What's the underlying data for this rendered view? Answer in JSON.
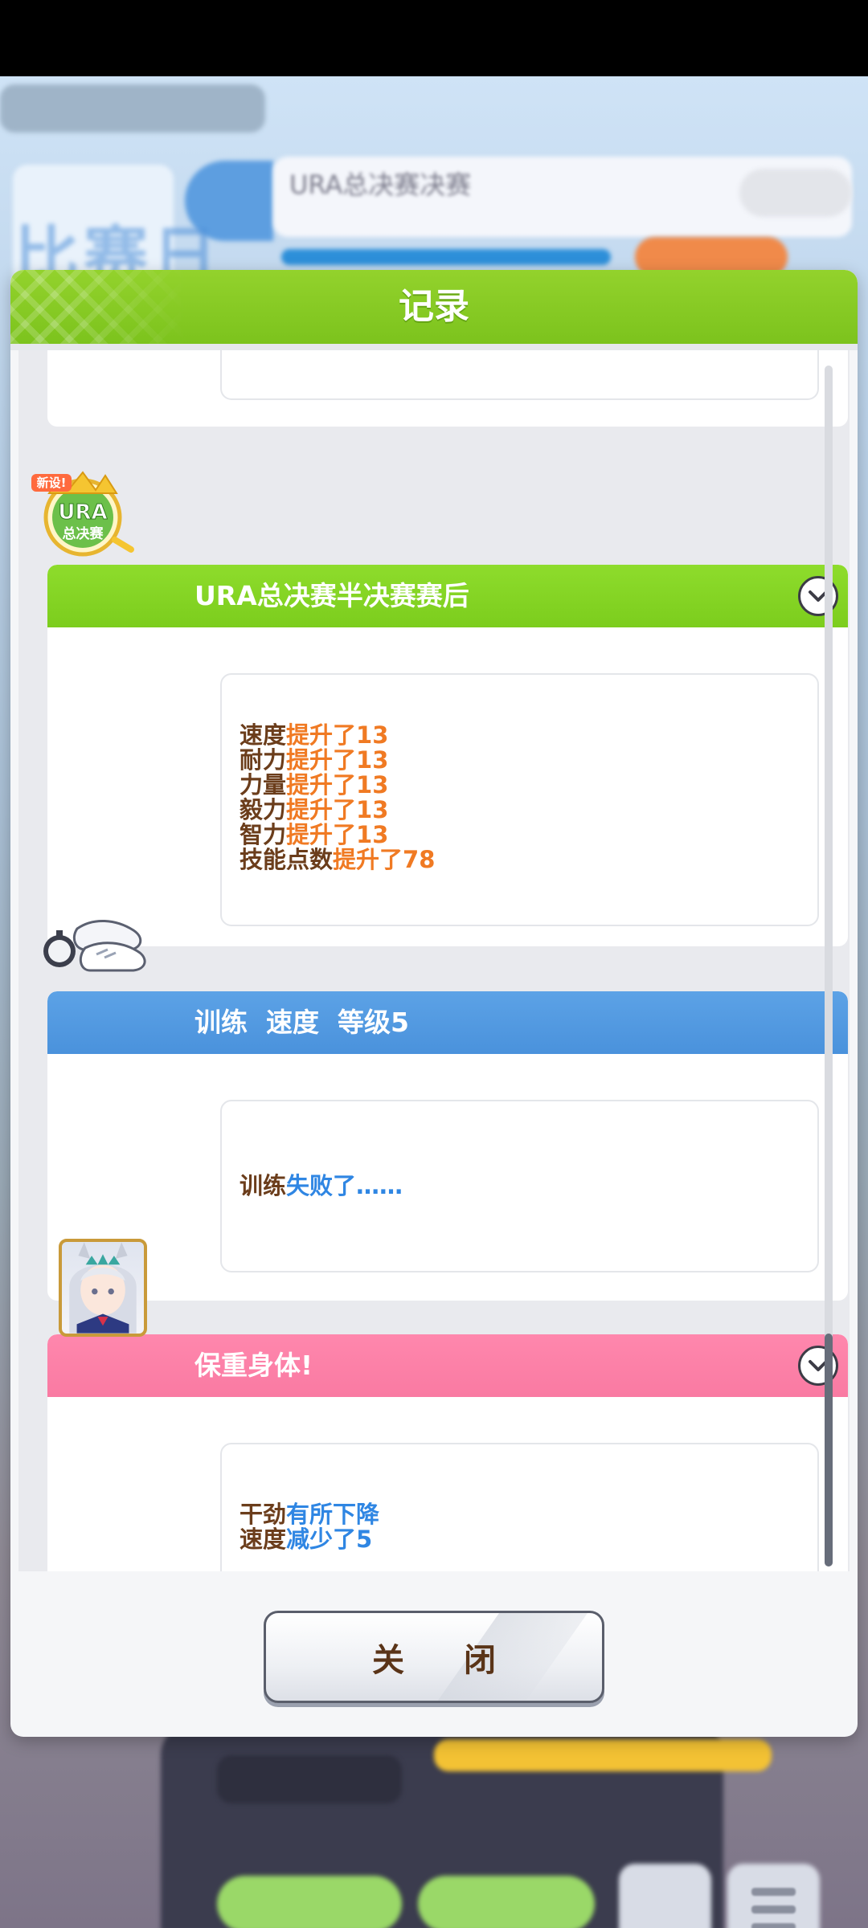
{
  "background": {
    "race_day_text": "比赛日",
    "race_info_text": "URA总决赛决赛"
  },
  "modal": {
    "title": "记录",
    "entries": [
      {
        "type": "event",
        "title": "URA总决赛半决赛赛后",
        "badge_text": "新设!URA总决赛",
        "banner_color": "#7ccd1d",
        "lines": [
          {
            "label": "速度",
            "value": "提升了13"
          },
          {
            "label": "耐力",
            "value": "提升了13"
          },
          {
            "label": "力量",
            "value": "提升了13"
          },
          {
            "label": "毅力",
            "value": "提升了13"
          },
          {
            "label": "智力",
            "value": "提升了13"
          },
          {
            "label": "技能点数",
            "value": "提升了78"
          }
        ]
      },
      {
        "type": "training",
        "title": "训练  速度  等级5",
        "banner_color": "#4a92dc",
        "lines": [
          {
            "label": "训练",
            "value": "失败了……"
          }
        ]
      },
      {
        "type": "event",
        "title": "保重身体!",
        "banner_color": "#f97aa2",
        "lines": [
          {
            "label": "干劲",
            "value": "有所下降"
          },
          {
            "label": "速度",
            "value": "减少了5"
          }
        ]
      }
    ],
    "close_label": "关 闭"
  },
  "colors": {
    "header_green": "#7cc31d",
    "label_brown": "#6b3d1b",
    "positive_orange": "#f07a23",
    "negative_blue": "#2f86e3"
  }
}
